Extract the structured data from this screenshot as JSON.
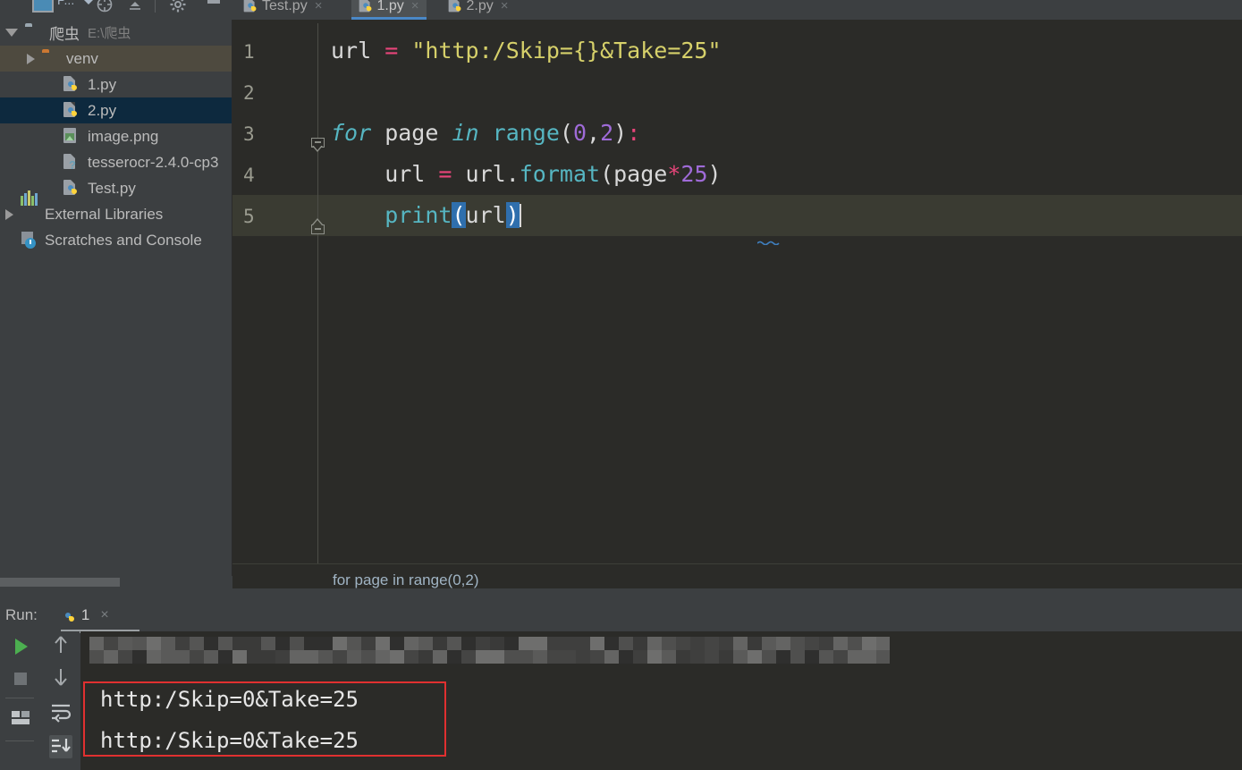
{
  "window": {
    "theme_bg": "#3c3f41",
    "editor_bg": "#2b2b28",
    "accent": "#4a88c7"
  },
  "toolbar": {
    "project_label": "P...",
    "icons": [
      "project-icon",
      "locate-icon",
      "collapse-all-icon",
      "settings-gear-icon",
      "hide-icon"
    ]
  },
  "tree": {
    "items": [
      {
        "label": "爬虫",
        "sub": "E:\\爬虫",
        "icon": "folder-gray-icon",
        "indent": 0,
        "twisty": "open",
        "state": "normal"
      },
      {
        "label": "venv",
        "sub": "",
        "icon": "folder-orange-icon",
        "indent": 1,
        "twisty": "closed",
        "state": "hover"
      },
      {
        "label": "1.py",
        "sub": "",
        "icon": "python-file-icon",
        "indent": 2,
        "twisty": "none",
        "state": "normal"
      },
      {
        "label": "2.py",
        "sub": "",
        "icon": "python-file-icon",
        "indent": 2,
        "twisty": "none",
        "state": "selected"
      },
      {
        "label": "image.png",
        "sub": "",
        "icon": "image-file-icon",
        "indent": 2,
        "twisty": "none",
        "state": "normal"
      },
      {
        "label": "tesserocr-2.4.0-cp3",
        "sub": "",
        "icon": "unknown-file-icon",
        "indent": 2,
        "twisty": "none",
        "state": "normal"
      },
      {
        "label": "Test.py",
        "sub": "",
        "icon": "python-file-icon",
        "indent": 2,
        "twisty": "none",
        "state": "normal"
      },
      {
        "label": "External Libraries",
        "sub": "",
        "icon": "external-libraries-icon",
        "indent": 0,
        "twisty": "closed",
        "state": "normal"
      },
      {
        "label": "Scratches and Console",
        "sub": "",
        "icon": "scratches-icon",
        "indent": 0,
        "twisty": "none",
        "state": "normal"
      }
    ]
  },
  "tabs": [
    {
      "label": "Test.py",
      "active": false
    },
    {
      "label": "1.py",
      "active": true
    },
    {
      "label": "2.py",
      "active": false
    }
  ],
  "editor": {
    "line_numbers": [
      "1",
      "2",
      "3",
      "4",
      "5"
    ],
    "lines": [
      {
        "n": "1",
        "tokens": [
          {
            "t": "url ",
            "c": "c-plain"
          },
          {
            "t": "=",
            "c": "c-op"
          },
          {
            "t": " ",
            "c": "c-plain"
          },
          {
            "t": "\"http:/Skip={}&Take=25\"",
            "c": "c-str"
          }
        ]
      },
      {
        "n": "2",
        "tokens": []
      },
      {
        "n": "3",
        "tokens": [
          {
            "t": "for",
            "c": "c-kw"
          },
          {
            "t": " page ",
            "c": "c-plain"
          },
          {
            "t": "in",
            "c": "c-kw"
          },
          {
            "t": " ",
            "c": "c-plain"
          },
          {
            "t": "range",
            "c": "c-fn"
          },
          {
            "t": "(",
            "c": "c-punct"
          },
          {
            "t": "0",
            "c": "c-num"
          },
          {
            "t": ",",
            "c": "c-punct"
          },
          {
            "t": "2",
            "c": "c-num"
          },
          {
            "t": ")",
            "c": "c-punct"
          },
          {
            "t": ":",
            "c": "c-op"
          }
        ]
      },
      {
        "n": "4",
        "tokens": [
          {
            "t": "    url ",
            "c": "c-plain"
          },
          {
            "t": "=",
            "c": "c-op"
          },
          {
            "t": " url.",
            "c": "c-plain"
          },
          {
            "t": "format",
            "c": "c-fn"
          },
          {
            "t": "(",
            "c": "c-punct"
          },
          {
            "t": "page",
            "c": "c-plain"
          },
          {
            "t": "*",
            "c": "c-op"
          },
          {
            "t": "25",
            "c": "c-num"
          },
          {
            "t": ")",
            "c": "c-punct"
          }
        ]
      },
      {
        "n": "5",
        "tokens": [
          {
            "t": "    ",
            "c": "c-plain"
          },
          {
            "t": "print",
            "c": "c-fn"
          },
          {
            "t": "(",
            "c": "c-paren-hl"
          },
          {
            "t": "url",
            "c": "c-plain"
          },
          {
            "t": ")",
            "c": "c-paren-hl"
          }
        ]
      }
    ],
    "caret_line": 5,
    "current_line": 5
  },
  "breadcrumb": {
    "text": "for page in range(0,2)"
  },
  "run_panel": {
    "label": "Run:",
    "tab_name": "1",
    "tab_close": "×",
    "left_toolbar": [
      "rerun-icon",
      "stop-icon",
      "layout-icon"
    ],
    "mid_toolbar": [
      "up-arrow-icon",
      "down-arrow-icon",
      "soft-wrap-icon",
      "scroll-to-end-icon"
    ],
    "console": {
      "censored_line_tail": "py",
      "output_lines": [
        "http:/Skip=0&Take=25",
        "http:/Skip=0&Take=25"
      ],
      "highlight_color": "#e03030"
    }
  }
}
